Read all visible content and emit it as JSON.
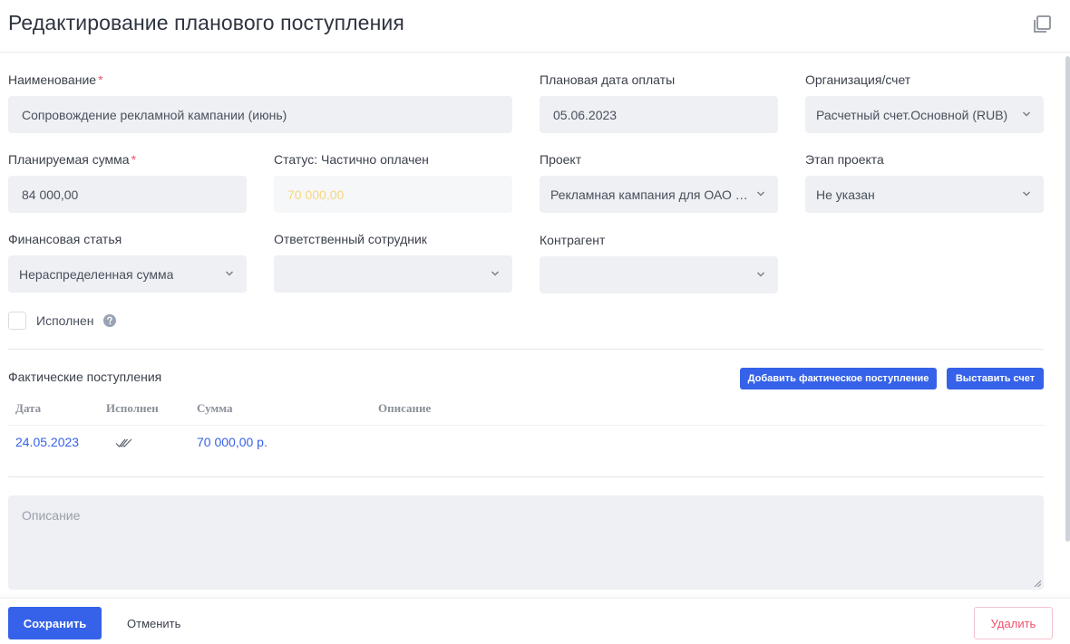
{
  "header": {
    "title": "Редактирование планового поступления"
  },
  "fields": {
    "name": {
      "label": "Наименование",
      "required": "*",
      "value": "Сопровождение рекламной кампании (июнь)"
    },
    "pay_date": {
      "label": "Плановая дата оплаты",
      "value": "05.06.2023"
    },
    "org_account": {
      "label": "Организация/счет",
      "value": "Расчетный счет.Основной (RUB)"
    },
    "planned_sum": {
      "label": "Планируемая сумма",
      "required": "*",
      "value": "84 000,00"
    },
    "status": {
      "label": "Статус: Частично оплачен",
      "value": "70 000,00"
    },
    "project": {
      "label": "Проект",
      "value": "Рекламная кампания для ОАО «Альфа»"
    },
    "project_stage": {
      "label": "Этап проекта",
      "value": "Не указан"
    },
    "fin_article": {
      "label": "Финансовая статья",
      "value": "Нераспределенная сумма"
    },
    "responsible": {
      "label": "Ответственный сотрудник",
      "value": ""
    },
    "counterparty": {
      "label": "Контрагент",
      "value": ""
    }
  },
  "done_checkbox": {
    "label": "Исполнен",
    "checked": false
  },
  "actual": {
    "title": "Фактические поступления",
    "add_button": "Добавить фактическое поступление",
    "invoice_button": "Выставить счет",
    "columns": [
      "Дата",
      "Исполнен",
      "Сумма",
      "Описание"
    ],
    "rows": [
      {
        "date": "24.05.2023",
        "done": true,
        "sum": "70 000,00 р.",
        "description": ""
      }
    ]
  },
  "description": {
    "placeholder": "Описание",
    "value": ""
  },
  "footer": {
    "save": "Сохранить",
    "cancel": "Отменить",
    "delete": "Удалить"
  },
  "colors": {
    "accent": "#3562e8",
    "danger": "#f0506e",
    "status_value": "#f6d77a",
    "field_bg": "#eef0f4"
  }
}
